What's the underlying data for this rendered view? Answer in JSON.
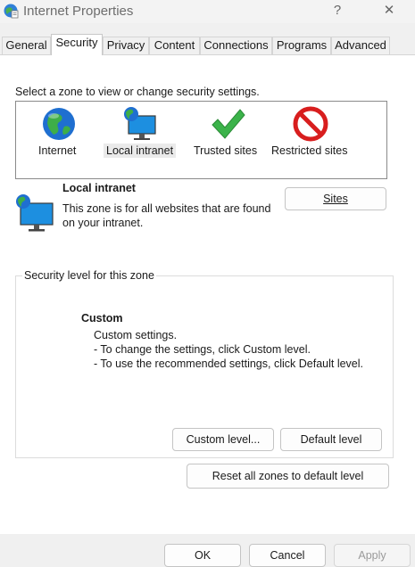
{
  "window": {
    "title": "Internet Properties",
    "help_glyph": "?",
    "close_glyph": "✕"
  },
  "tabs": [
    {
      "label": "General"
    },
    {
      "label": "Security",
      "active": true
    },
    {
      "label": "Privacy"
    },
    {
      "label": "Content"
    },
    {
      "label": "Connections"
    },
    {
      "label": "Programs"
    },
    {
      "label": "Advanced"
    }
  ],
  "security": {
    "zone_prompt": "Select a zone to view or change security settings.",
    "zones": [
      {
        "label": "Internet",
        "icon": "globe-icon"
      },
      {
        "label": "Local intranet",
        "icon": "monitor-globe-icon",
        "selected": true
      },
      {
        "label": "Trusted sites",
        "icon": "checkmark-icon"
      },
      {
        "label": "Restricted sites",
        "icon": "no-entry-icon"
      }
    ],
    "selected_zone": {
      "name": "Local intranet",
      "description": "This zone is for all websites that are found on your intranet.",
      "sites_button": "Sites"
    },
    "level_group": {
      "legend": "Security level for this zone",
      "level_name": "Custom",
      "lines": [
        "Custom settings.",
        "- To change the settings, click Custom level.",
        "- To use the recommended settings, click Default level."
      ],
      "custom_level_button": "Custom level...",
      "default_level_button": "Default level"
    },
    "reset_button": "Reset all zones to default level"
  },
  "footer": {
    "ok": "OK",
    "cancel": "Cancel",
    "apply": "Apply"
  },
  "colors": {
    "accent_green": "#3bb34a",
    "restricted_red": "#d81e1e",
    "globe_blue": "#1f6fd0"
  }
}
